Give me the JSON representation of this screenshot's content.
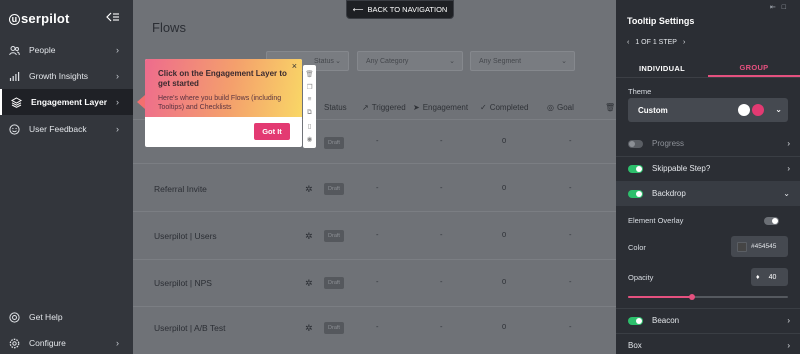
{
  "sidebar": {
    "logo": "userpilot",
    "items": [
      {
        "label": "People"
      },
      {
        "label": "Growth Insights"
      },
      {
        "label": "Engagement Layer"
      },
      {
        "label": "User Feedback"
      }
    ],
    "bottom_items": [
      {
        "label": "Get Help"
      },
      {
        "label": "Configure"
      }
    ]
  },
  "main": {
    "title": "Flows",
    "back_nav": "BACK TO NAVIGATION",
    "filters": [
      {
        "label": "Status"
      },
      {
        "label": "Any Category"
      },
      {
        "label": "Any Segment"
      }
    ],
    "columns": [
      "Status",
      "Triggered",
      "Engagement",
      "Completed",
      "Goal"
    ],
    "rows": [
      {
        "name": "",
        "status": "Draft",
        "triggered": "-",
        "engagement": "-",
        "completed": "0",
        "goal": "-"
      },
      {
        "name": "Referral Invite",
        "status": "Draft",
        "triggered": "-",
        "engagement": "-",
        "completed": "0",
        "goal": "-"
      },
      {
        "name": "Userpilot | Users",
        "status": "Draft",
        "triggered": "-",
        "engagement": "-",
        "completed": "0",
        "goal": "-"
      },
      {
        "name": "Userpilot | NPS",
        "status": "Draft",
        "triggered": "-",
        "engagement": "-",
        "completed": "0",
        "goal": "-"
      },
      {
        "name": "Userpilot | A/B Test",
        "status": "Draft",
        "triggered": "-",
        "engagement": "-",
        "completed": "0",
        "goal": "-"
      }
    ],
    "tooltip": {
      "title": "Click on the Engagement Layer to get started",
      "body": "Here's where you build Flows (including Tooltips) and Checklists",
      "button": "Got It",
      "close": "×"
    }
  },
  "panel": {
    "title": "Tooltip Settings",
    "step": "1 OF 1 STEP",
    "tabs": [
      "INDIVIDUAL",
      "GROUP"
    ],
    "active_tab": "GROUP",
    "theme_label": "Theme",
    "theme_value": "Custom",
    "rows": {
      "progress": "Progress",
      "skippable": "Skippable Step?",
      "backdrop": "Backdrop",
      "element_overlay": "Element Overlay",
      "color": "Color",
      "opacity": "Opacity",
      "beacon": "Beacon",
      "box": "Box"
    },
    "color_value": "#454545",
    "opacity_value": "40",
    "opacity_fraction": 0.4,
    "colors": {
      "accent": "#e5517f",
      "toggle_on": "#2dbf6c",
      "button": "#e33a72"
    }
  }
}
